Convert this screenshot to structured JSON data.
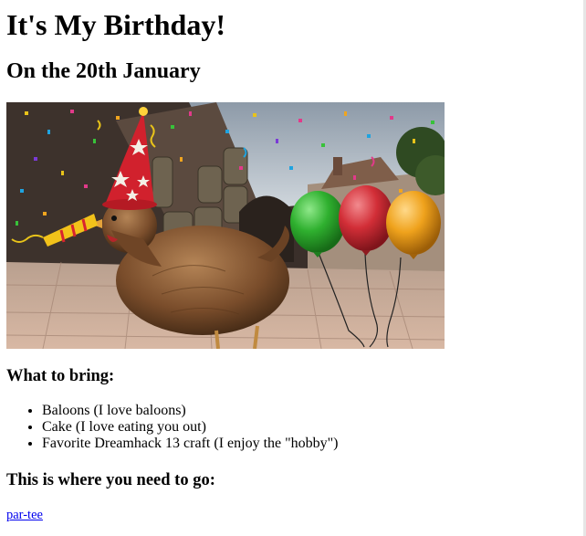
{
  "page": {
    "title": "It's My Birthday!",
    "subtitle": "On the 20th January",
    "what_to_bring": {
      "heading": "What to bring:",
      "items": [
        "Baloons (I love baloons)",
        "Cake (I love eating you out)",
        "Favorite Dreamhack 13 craft (I enjoy the \"hobby\")"
      ]
    },
    "where_to_go": {
      "heading": "This is where you need to go:",
      "link_text": "par-tee"
    }
  },
  "colors": {
    "link": "#0000ee",
    "balloon_green": "#33b533",
    "balloon_red": "#d8333b",
    "balloon_orange": "#f0a51f",
    "hat_red": "#d1212d"
  },
  "icons": [
    "party-hat-icon",
    "party-horn-icon",
    "balloon-icon"
  ]
}
